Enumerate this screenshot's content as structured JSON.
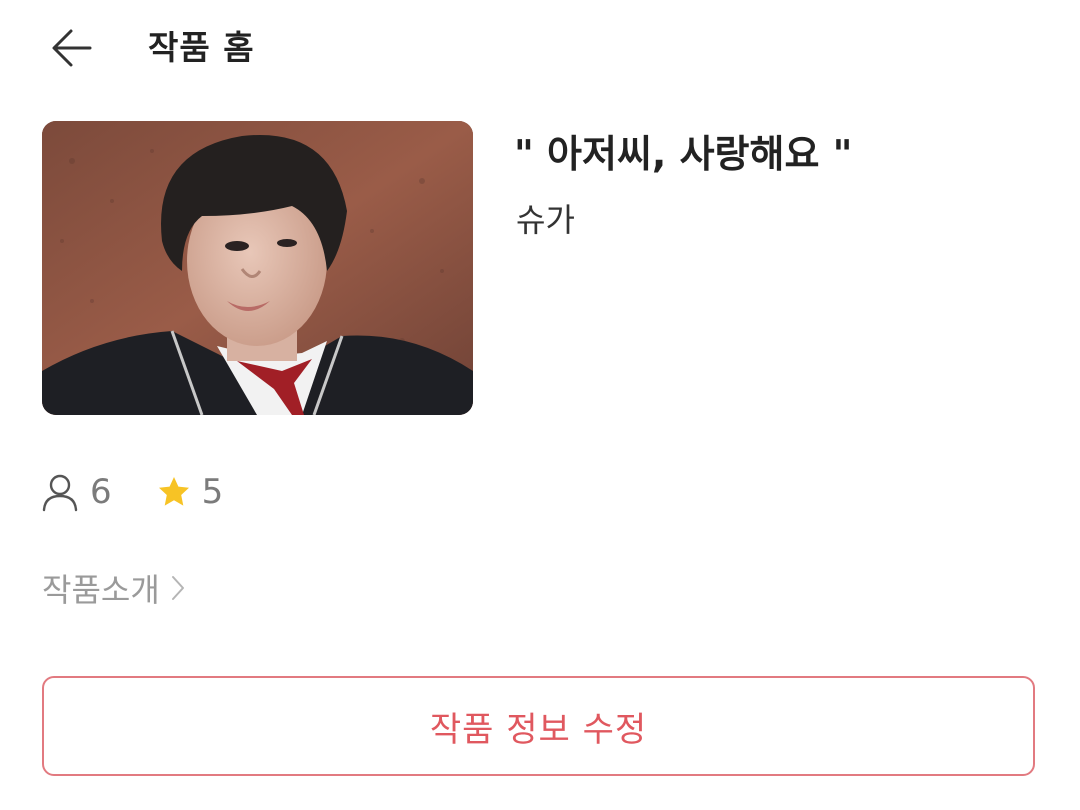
{
  "header": {
    "title": "작품 홈",
    "back_icon": "arrow-left-icon"
  },
  "work": {
    "title": "\" 아저씨, 사랑해요 \"",
    "author": "슈가",
    "cover_icon": "cover-image"
  },
  "stats": {
    "readers_icon": "person-icon",
    "readers": "6",
    "rating_icon": "star-icon",
    "rating": "5"
  },
  "intro": {
    "label": "작품소개",
    "chevron_icon": "chevron-right-icon"
  },
  "actions": {
    "edit_label": "작품 정보 수정"
  },
  "colors": {
    "accent": "#e0585f",
    "accent_border": "#e27a80",
    "star": "#f7c325",
    "muted": "#9a9a9a"
  }
}
